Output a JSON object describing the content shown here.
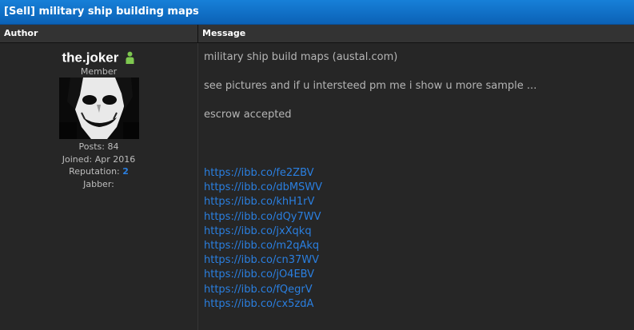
{
  "thread": {
    "title": "[Sell] military ship building maps"
  },
  "columns": {
    "author": "Author",
    "message": "Message"
  },
  "author": {
    "username": "the.joker",
    "online_status_icon": "online-person-icon",
    "online_color": "#7ec850",
    "rank": "Member",
    "posts": "Posts: 84",
    "joined": "Joined: Apr 2016",
    "reputation_label": "Reputation:",
    "reputation_value": "2",
    "jabber": "Jabber:"
  },
  "post": {
    "line1": "military ship build maps (austal.com)",
    "line2": "see pictures and if u intersteed pm me i show u more sample ...",
    "line3": "escrow accepted",
    "links": [
      "https://ibb.co/fe2ZBV",
      "https://ibb.co/dbMSWV",
      "https://ibb.co/khH1rV",
      "https://ibb.co/dQy7WV",
      "https://ibb.co/jxXqkq",
      "https://ibb.co/m2qAkq",
      "https://ibb.co/cn37WV",
      "https://ibb.co/jO4EBV",
      "https://ibb.co/fQegrV",
      "https://ibb.co/cx5zdA"
    ]
  },
  "colors": {
    "header_blue": "#1780d8",
    "link_blue": "#2a7fe0",
    "background": "#262626"
  }
}
